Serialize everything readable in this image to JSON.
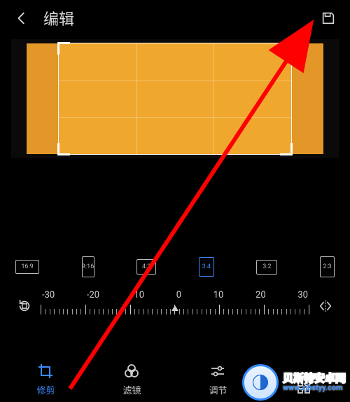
{
  "header": {
    "title": "编辑"
  },
  "ratios": [
    {
      "label": "16:9",
      "cls": "rb-169",
      "active": false
    },
    {
      "label": "9:16",
      "cls": "rb-916",
      "active": false
    },
    {
      "label": "4:3",
      "cls": "rb-43",
      "active": false
    },
    {
      "label": "3:4",
      "cls": "rb-34",
      "active": true
    },
    {
      "label": "3:2",
      "cls": "rb-32",
      "active": false
    },
    {
      "label": "2:3",
      "cls": "rb-23",
      "active": false
    }
  ],
  "angle_labels": [
    "-30",
    "-20",
    "-10",
    "0",
    "10",
    "20",
    "30"
  ],
  "tabs": [
    {
      "label": "修剪",
      "active": true
    },
    {
      "label": "滤镜",
      "active": false
    },
    {
      "label": "调节",
      "active": false
    },
    {
      "label": "",
      "active": false
    }
  ],
  "watermark": {
    "line1": "贝斯特安卓网",
    "line2": "www.zjbstyy.com"
  }
}
